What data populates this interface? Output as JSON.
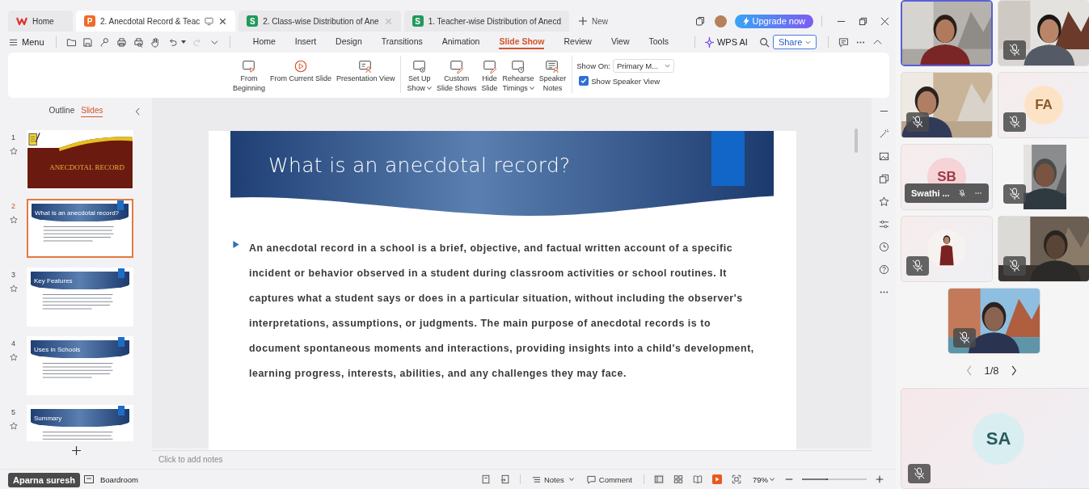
{
  "tabs": [
    {
      "label": "Home",
      "kind": "home",
      "selected": false,
      "closable": false
    },
    {
      "label": "2. Anecdotal Record & Teac",
      "kind": "presentation",
      "icon_letter": "P",
      "selected": true,
      "closable": true
    },
    {
      "label": "2. Class-wise Distribution of Ane",
      "kind": "sheet",
      "icon_letter": "S",
      "selected": false,
      "closable": true
    },
    {
      "label": "1. Teacher-wise Distribution of Anecd",
      "kind": "sheet",
      "icon_letter": "S",
      "selected": false,
      "closable": false
    }
  ],
  "new_tab": "New",
  "upgrade": "Upgrade now",
  "menu": "Menu",
  "ribbon_tabs": [
    {
      "label": "Home",
      "selected": false
    },
    {
      "label": "Insert",
      "selected": false
    },
    {
      "label": "Design",
      "selected": false
    },
    {
      "label": "Transitions",
      "selected": false
    },
    {
      "label": "Animation",
      "selected": false
    },
    {
      "label": "Slide Show",
      "selected": true
    },
    {
      "label": "Review",
      "selected": false
    },
    {
      "label": "View",
      "selected": false
    },
    {
      "label": "Tools",
      "selected": false
    }
  ],
  "wps_ai": "WPS AI",
  "share": "Share",
  "ribbon_buttons": [
    {
      "kind": "from-beginning",
      "lines": [
        "From",
        "Beginning"
      ],
      "dropdown": false
    },
    {
      "kind": "from-current",
      "lines": [
        "From Current Slide"
      ],
      "dropdown": false
    },
    {
      "kind": "presentation-view",
      "lines": [
        "Presentation View"
      ],
      "dropdown": false
    },
    {
      "kind": "set-up",
      "lines": [
        "Set Up",
        "Show"
      ],
      "dropdown": true
    },
    {
      "kind": "custom",
      "lines": [
        "Custom",
        "Slide Shows"
      ],
      "dropdown": false
    },
    {
      "kind": "hide",
      "lines": [
        "Hide",
        "Slide"
      ],
      "dropdown": false
    },
    {
      "kind": "rehearse",
      "lines": [
        "Rehearse",
        "Timings"
      ],
      "dropdown": true
    },
    {
      "kind": "speaker-notes",
      "lines": [
        "Speaker",
        "Notes"
      ],
      "dropdown": false
    }
  ],
  "show_on": {
    "label": "Show On:",
    "value": "Primary M..."
  },
  "speaker_view": {
    "label": "Show Speaker View",
    "checked": true
  },
  "panel_tabs": [
    {
      "label": "Outline",
      "selected": false
    },
    {
      "label": "Slides",
      "selected": true
    }
  ],
  "thumbnails": [
    {
      "number": "1",
      "kind": "title",
      "title": "ANECDOTAL RECORD",
      "selected": false
    },
    {
      "number": "2",
      "kind": "content",
      "title": "What is an anecdotal record?",
      "selected": true
    },
    {
      "number": "3",
      "kind": "content",
      "title": "Key Features",
      "selected": false
    },
    {
      "number": "4",
      "kind": "content",
      "title": "Uses in Schools",
      "selected": false
    },
    {
      "number": "5",
      "kind": "content",
      "title": "Summary",
      "selected": false
    }
  ],
  "slide": {
    "title": "What is an anecdotal record?",
    "text": "An anecdotal record in a school is a brief, objective, and factual written account of a specific incident or behavior observed in a student during classroom activities or school routines. It captures what a student says or does in a particular situation, without including the observer's interpretations, assumptions, or judgments. The main purpose of anecdotal records is to document spontaneous moments and interactions, providing insights into a child's development, learning progress, interests, abilities, and any challenges they may face."
  },
  "notes_placeholder": "Click to add notes",
  "status": {
    "theme": "Boardroom",
    "notes": "Notes",
    "comment": "Comment",
    "zoom": "79%"
  },
  "zoom_slider": {
    "level": 0.38
  },
  "presenter": "Aparna suresh",
  "participants": [
    {
      "kind": "video",
      "active": true,
      "muted": false
    },
    {
      "kind": "video",
      "active": false,
      "muted": true
    },
    {
      "kind": "video",
      "active": false,
      "muted": true
    },
    {
      "kind": "initials",
      "initials": "FA",
      "color": "#fde3c6",
      "active": false,
      "muted": true
    },
    {
      "kind": "initials",
      "initials": "SB",
      "name": "Swathi ...",
      "color": "#f5d3d6",
      "active": false,
      "muted": true
    },
    {
      "kind": "narrow-video",
      "active": false,
      "muted": true
    },
    {
      "kind": "photo-avatar",
      "active": false,
      "muted": true
    },
    {
      "kind": "video",
      "active": false,
      "muted": true
    },
    {
      "kind": "video",
      "active": false,
      "muted": true
    }
  ],
  "pager": "1/8",
  "self_tile": {
    "initials": "SA",
    "color": "#d9eef0",
    "muted": true
  }
}
